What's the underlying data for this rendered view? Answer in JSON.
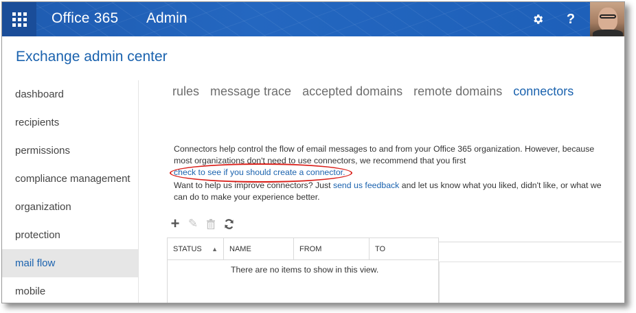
{
  "topbar": {
    "brand": "Office 365",
    "app": "Admin",
    "waffle_icon": "app-launcher-icon",
    "settings_icon": "gear-icon",
    "help_label": "?",
    "colors": {
      "bar": "#1f5fb4",
      "accent": "#1a62ae"
    }
  },
  "header": {
    "title": "Exchange admin center"
  },
  "nav": {
    "items": [
      {
        "label": "dashboard"
      },
      {
        "label": "recipients"
      },
      {
        "label": "permissions"
      },
      {
        "label": "compliance management"
      },
      {
        "label": "organization"
      },
      {
        "label": "protection"
      },
      {
        "label": "mail flow",
        "active": true
      },
      {
        "label": "mobile"
      }
    ]
  },
  "tabs": [
    {
      "label": "rules"
    },
    {
      "label": "message trace"
    },
    {
      "label": "accepted domains"
    },
    {
      "label": "remote domains"
    },
    {
      "label": "connectors",
      "active": true
    }
  ],
  "description": {
    "p1_text": "Connectors help control the flow of email messages to and from your Office 365 organization. However, because most organizations don't need to use connectors, we recommend that you first ",
    "p1_link": "check to see if you should create a connector.",
    "p2_prefix": "Want to help us improve connectors? Just ",
    "p2_link": "send us feedback",
    "p2_suffix": " and let us know what you liked, didn't like, or what we can do to make your experience better."
  },
  "toolbar": {
    "add_icon": "plus-icon",
    "edit_icon": "pencil-icon",
    "delete_icon": "trash-icon",
    "refresh_icon": "refresh-icon"
  },
  "table": {
    "columns": [
      "STATUS",
      "NAME",
      "FROM",
      "TO"
    ],
    "sort_indicator": "▲",
    "empty_message": "There are no items to show in this view."
  }
}
